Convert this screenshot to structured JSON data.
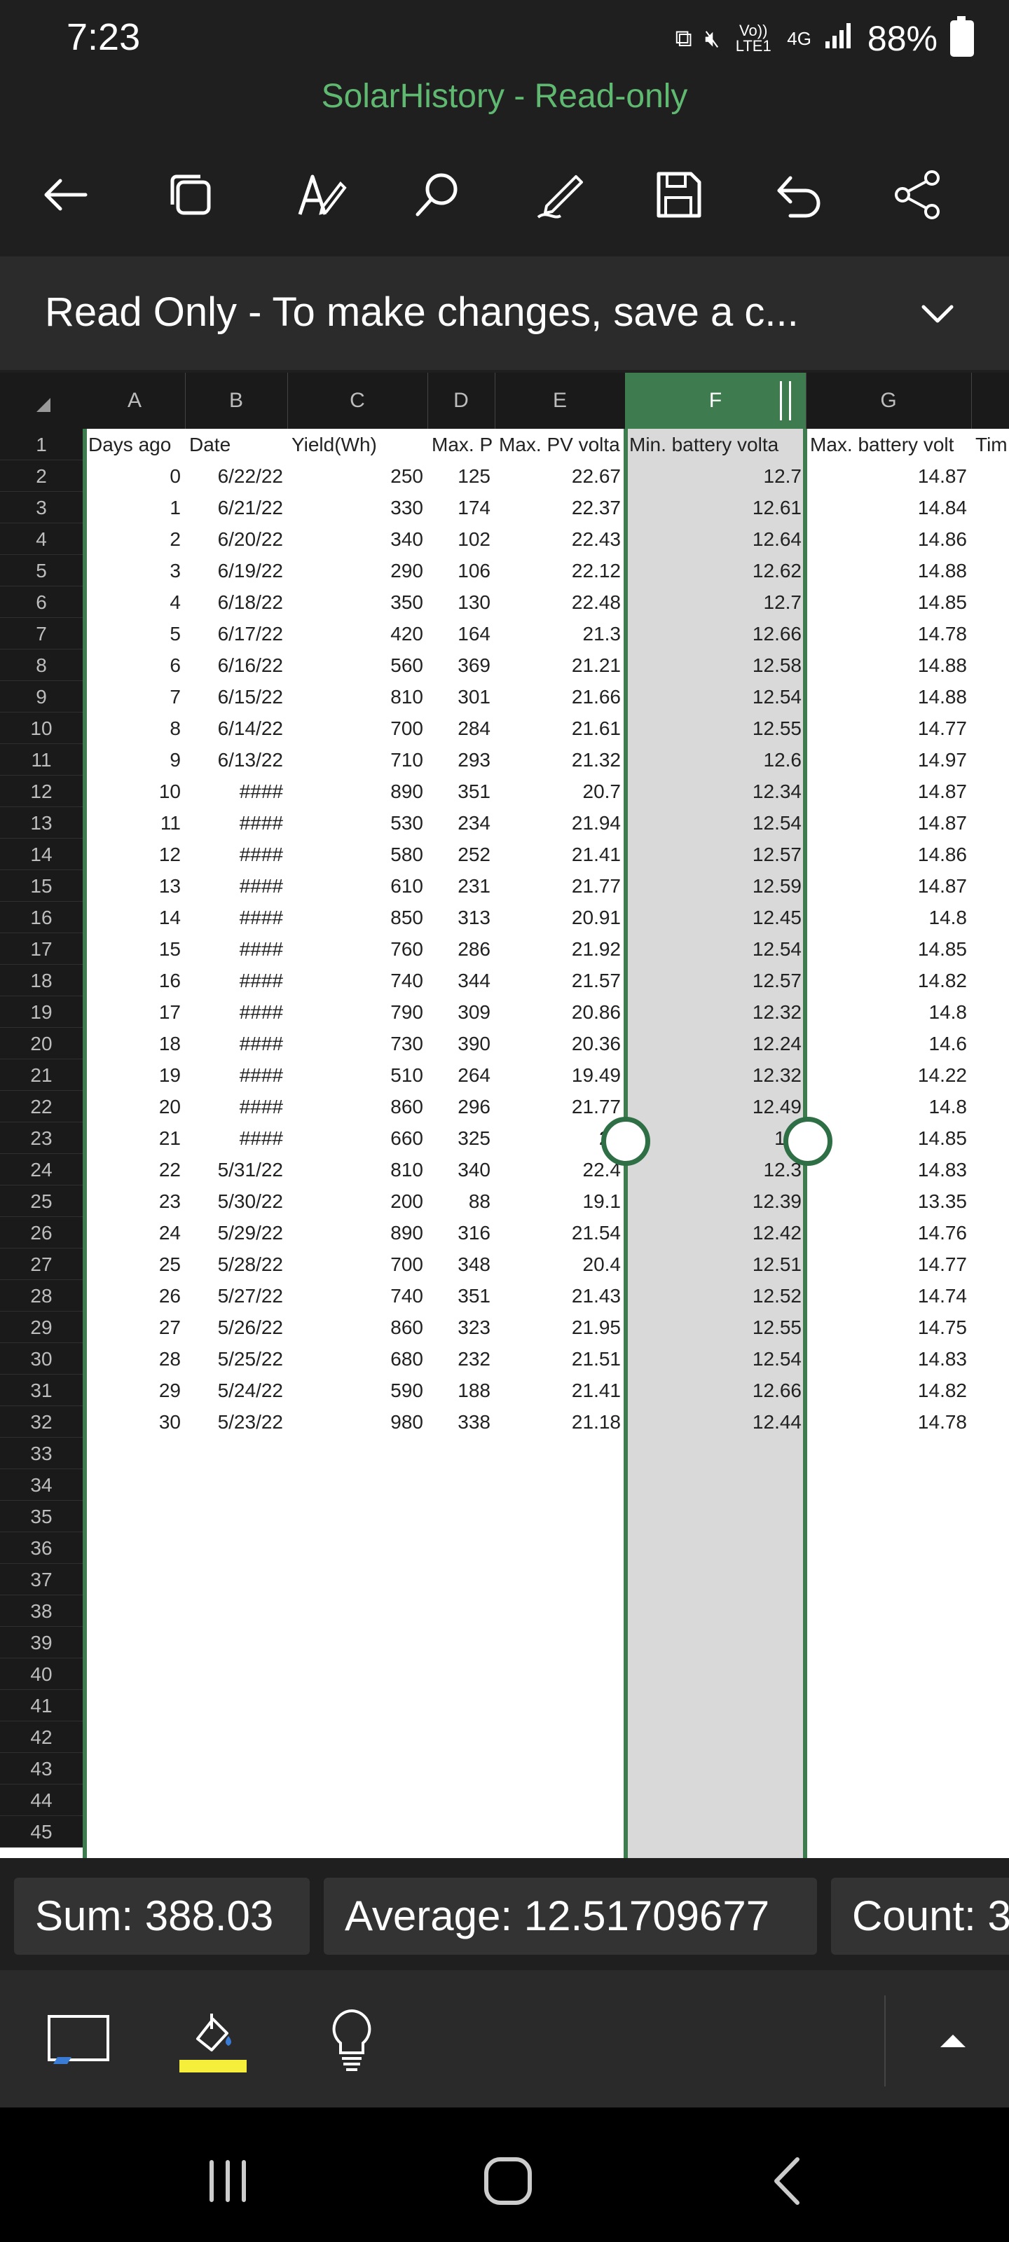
{
  "status": {
    "time": "7:23",
    "network": "4G",
    "volte": "Vo)) LTE1",
    "battery": "88%"
  },
  "title": "SolarHistory - Read-only",
  "banner": {
    "text": "Read Only - To make changes, save a c..."
  },
  "columns": [
    "A",
    "B",
    "C",
    "D",
    "E",
    "F",
    "G"
  ],
  "headers": [
    "Days ago",
    "Date",
    "Yield(Wh)",
    "Max. P",
    "Max. PV volta",
    "Min. battery volta",
    "Max. battery volt",
    "Tim"
  ],
  "rows": [
    [
      "0",
      "6/22/22",
      "250",
      "125",
      "22.67",
      "12.7",
      "14.87"
    ],
    [
      "1",
      "6/21/22",
      "330",
      "174",
      "22.37",
      "12.61",
      "14.84"
    ],
    [
      "2",
      "6/20/22",
      "340",
      "102",
      "22.43",
      "12.64",
      "14.86"
    ],
    [
      "3",
      "6/19/22",
      "290",
      "106",
      "22.12",
      "12.62",
      "14.88"
    ],
    [
      "4",
      "6/18/22",
      "350",
      "130",
      "22.48",
      "12.7",
      "14.85"
    ],
    [
      "5",
      "6/17/22",
      "420",
      "164",
      "21.3",
      "12.66",
      "14.78"
    ],
    [
      "6",
      "6/16/22",
      "560",
      "369",
      "21.21",
      "12.58",
      "14.88"
    ],
    [
      "7",
      "6/15/22",
      "810",
      "301",
      "21.66",
      "12.54",
      "14.88"
    ],
    [
      "8",
      "6/14/22",
      "700",
      "284",
      "21.61",
      "12.55",
      "14.77"
    ],
    [
      "9",
      "6/13/22",
      "710",
      "293",
      "21.32",
      "12.6",
      "14.97"
    ],
    [
      "10",
      "####",
      "890",
      "351",
      "20.7",
      "12.34",
      "14.87"
    ],
    [
      "11",
      "####",
      "530",
      "234",
      "21.94",
      "12.54",
      "14.87"
    ],
    [
      "12",
      "####",
      "580",
      "252",
      "21.41",
      "12.57",
      "14.86"
    ],
    [
      "13",
      "####",
      "610",
      "231",
      "21.77",
      "12.59",
      "14.87"
    ],
    [
      "14",
      "####",
      "850",
      "313",
      "20.91",
      "12.45",
      "14.8"
    ],
    [
      "15",
      "####",
      "760",
      "286",
      "21.92",
      "12.54",
      "14.85"
    ],
    [
      "16",
      "####",
      "740",
      "344",
      "21.57",
      "12.57",
      "14.82"
    ],
    [
      "17",
      "####",
      "790",
      "309",
      "20.86",
      "12.32",
      "14.8"
    ],
    [
      "18",
      "####",
      "730",
      "390",
      "20.36",
      "12.24",
      "14.6"
    ],
    [
      "19",
      "####",
      "510",
      "264",
      "19.49",
      "12.32",
      "14.22"
    ],
    [
      "20",
      "####",
      "860",
      "296",
      "21.77",
      "12.49",
      "14.8"
    ],
    [
      "21",
      "####",
      "660",
      "325",
      "21",
      "12.",
      "14.85"
    ],
    [
      "22",
      "5/31/22",
      "810",
      "340",
      "22.4",
      "12.3",
      "14.83"
    ],
    [
      "23",
      "5/30/22",
      "200",
      "88",
      "19.1",
      "12.39",
      "13.35"
    ],
    [
      "24",
      "5/29/22",
      "890",
      "316",
      "21.54",
      "12.42",
      "14.76"
    ],
    [
      "25",
      "5/28/22",
      "700",
      "348",
      "20.4",
      "12.51",
      "14.77"
    ],
    [
      "26",
      "5/27/22",
      "740",
      "351",
      "21.43",
      "12.52",
      "14.74"
    ],
    [
      "27",
      "5/26/22",
      "860",
      "323",
      "21.95",
      "12.55",
      "14.75"
    ],
    [
      "28",
      "5/25/22",
      "680",
      "232",
      "21.51",
      "12.54",
      "14.83"
    ],
    [
      "29",
      "5/24/22",
      "590",
      "188",
      "21.41",
      "12.66",
      "14.82"
    ],
    [
      "30",
      "5/23/22",
      "980",
      "338",
      "21.18",
      "12.44",
      "14.78"
    ]
  ],
  "row_count": 45,
  "summary": {
    "sum": "Sum: 388.03",
    "average": "Average: 12.51709677",
    "count": "Count: 3"
  },
  "icons": {
    "toolbar": [
      "back-arrow-icon",
      "copy-icon",
      "text-format-icon",
      "search-icon",
      "draw-pen-icon",
      "save-icon",
      "undo-icon",
      "share-icon"
    ],
    "bottom": [
      "present-icon",
      "fill-color-icon",
      "lightbulb-icon",
      "expand-up-icon"
    ],
    "accent": "#3e7c4f",
    "title_color": "#5fb971",
    "fill_highlight": "#f5ee3a"
  }
}
